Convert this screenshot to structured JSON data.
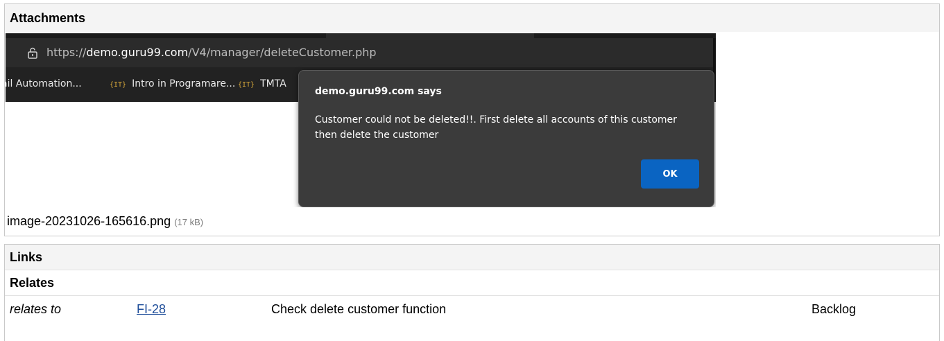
{
  "attachments": {
    "header": "Attachments",
    "screenshot": {
      "url_prefix": "https://",
      "url_domain": "demo.guru99.com",
      "url_path": "/V4/manager/deleteCustomer.php",
      "bookmarks": [
        {
          "icon": "",
          "label": "ail Automation..."
        },
        {
          "icon": "{IT}",
          "label": "Intro in Programare..."
        },
        {
          "icon": "{IT}",
          "label": "TMTA"
        }
      ],
      "dialog": {
        "title": "demo.guru99.com says",
        "message": "Customer could not be deleted!!. First delete all accounts of this customer then delete the customer",
        "ok_label": "OK"
      }
    },
    "filename": "image-20231026-165616.png",
    "filesize": "(17 kB)"
  },
  "links": {
    "header": "Links",
    "group": "Relates",
    "items": [
      {
        "relation": "relates to",
        "key": "FI-28",
        "summary": "Check delete customer function",
        "status": "Backlog"
      }
    ]
  }
}
